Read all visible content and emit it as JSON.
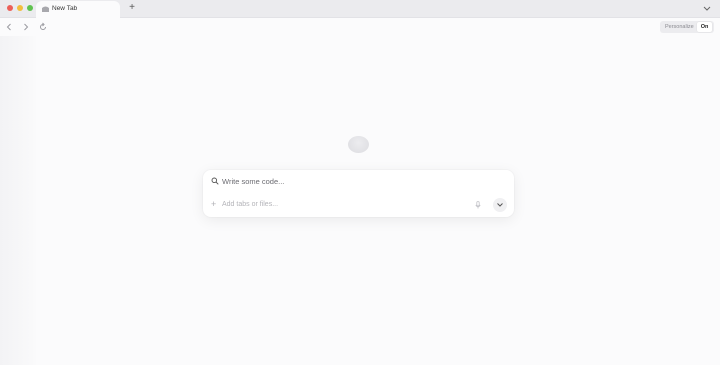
{
  "window": {
    "tab": {
      "title": "New Tab"
    },
    "new_tab_label": "+"
  },
  "toolbar": {
    "personalize": {
      "label": "Personalize",
      "value": "On"
    }
  },
  "prompt": {
    "placeholder": "Write some code...",
    "add_label": "Add tabs or files...",
    "add_icon": "+"
  },
  "icons": {
    "tab": "browser-favicon",
    "search": "search-icon",
    "mic": "microphone-icon",
    "more": "chevron-down-icon"
  },
  "colors": {
    "close": "#ec5f58",
    "minimize": "#f2be3d",
    "maximize": "#5fc24f",
    "tabstrip": "#ebebee",
    "page": "#fbfbfc"
  }
}
